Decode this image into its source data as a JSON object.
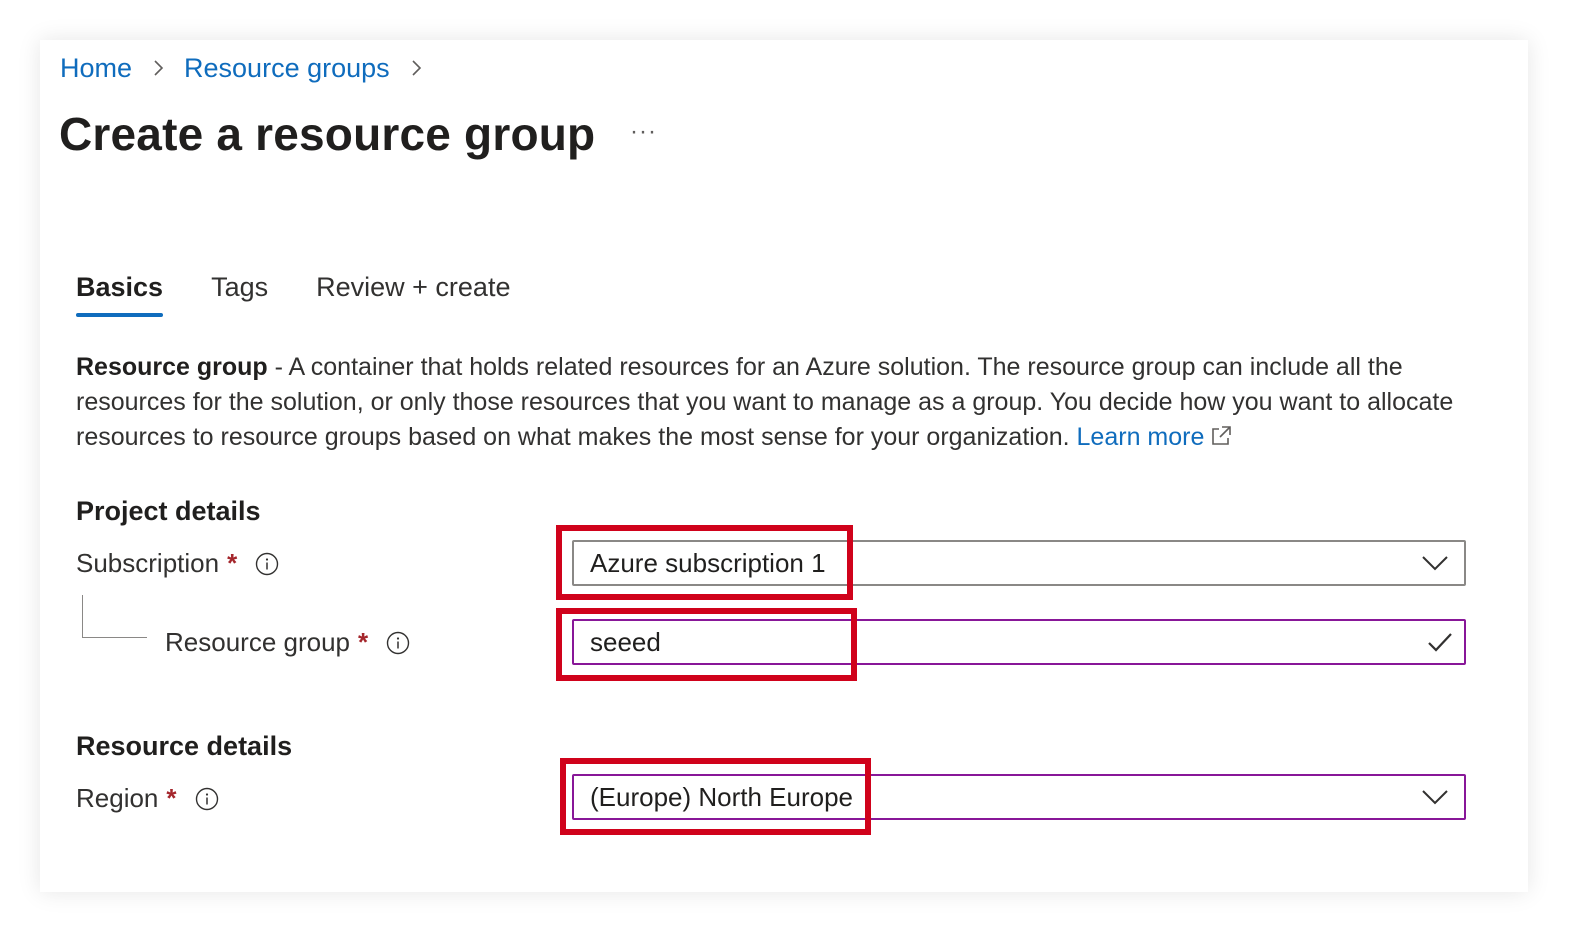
{
  "breadcrumb": {
    "home": "Home",
    "resource_groups": "Resource groups"
  },
  "page": {
    "title": "Create a resource group",
    "more": "···"
  },
  "tabs": [
    {
      "label": "Basics",
      "active": true
    },
    {
      "label": "Tags",
      "active": false
    },
    {
      "label": "Review + create",
      "active": false
    }
  ],
  "description": {
    "term": "Resource group",
    "text": " - A container that holds related resources for an Azure solution. The resource group can include all the resources for the solution, or only those resources that you want to manage as a group. You decide how you want to allocate resources to resource groups based on what makes the most sense for your organization. ",
    "learn_more": "Learn more"
  },
  "project_details": {
    "title": "Project details",
    "subscription": {
      "label": "Subscription",
      "required": "*",
      "value": "Azure subscription 1"
    },
    "resource_group": {
      "label": "Resource group",
      "required": "*",
      "value": "seeed"
    }
  },
  "resource_details": {
    "title": "Resource details",
    "region": {
      "label": "Region",
      "required": "*",
      "value": "(Europe) North Europe"
    }
  },
  "colors": {
    "link": "#0f6cbd",
    "focus_border": "#881798",
    "required": "#a4262c",
    "highlight": "#d0021b"
  }
}
